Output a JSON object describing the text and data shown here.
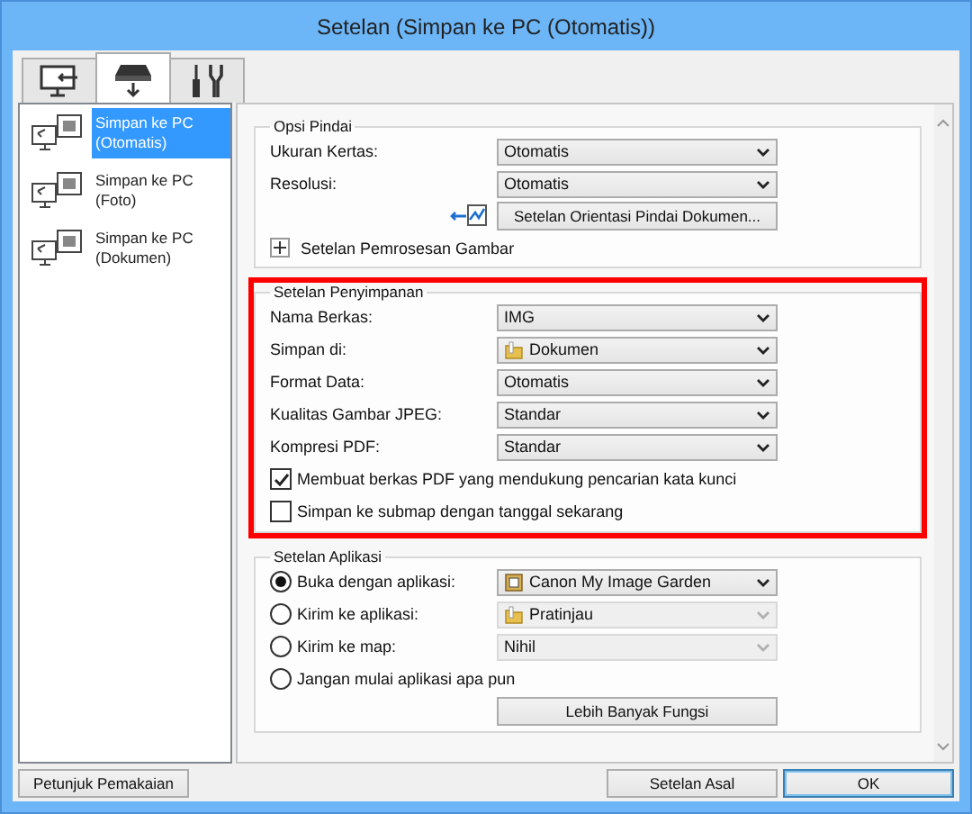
{
  "window": {
    "title": "Setelan (Simpan ke PC (Otomatis))"
  },
  "tabs": [
    {
      "kind": "monitor",
      "selected": false
    },
    {
      "kind": "scanner",
      "selected": true
    },
    {
      "kind": "tools",
      "selected": false
    }
  ],
  "sidebar": {
    "items": [
      {
        "label": "Simpan ke PC\n(Otomatis)",
        "selected": true
      },
      {
        "label": "Simpan ke PC\n(Foto)",
        "selected": false
      },
      {
        "label": "Simpan ke PC\n(Dokumen)",
        "selected": false
      }
    ]
  },
  "sections": [
    {
      "title": "Opsi Pindai",
      "highlighted": false,
      "rows": [
        {
          "kind": "dropdown",
          "label": "Ukuran Kertas:",
          "dropdown": {
            "kind": "plain",
            "value": "Otomatis",
            "disabled": false
          }
        },
        {
          "kind": "dropdown",
          "label": "Resolusi:",
          "dropdown": {
            "kind": "plain",
            "value": "Otomatis",
            "disabled": false
          }
        },
        {
          "kind": "button",
          "label": "Setelan Orientasi Pindai Dokumen..."
        },
        {
          "kind": "expander",
          "label": "Setelan Pemrosesan Gambar",
          "expanded": false
        }
      ]
    },
    {
      "title": "Setelan Penyimpanan",
      "highlighted": true,
      "rows": [
        {
          "kind": "dropdown",
          "label": "Nama Berkas:",
          "dropdown": {
            "kind": "plain",
            "value": "IMG",
            "disabled": false
          }
        },
        {
          "kind": "dropdown",
          "label": "Simpan di:",
          "dropdown": {
            "kind": "folder",
            "value": "Dokumen",
            "disabled": false
          }
        },
        {
          "kind": "dropdown",
          "label": "Format Data:",
          "dropdown": {
            "kind": "plain",
            "value": "Otomatis",
            "disabled": false
          }
        },
        {
          "kind": "dropdown",
          "label": "Kualitas Gambar JPEG:",
          "dropdown": {
            "kind": "plain",
            "value": "Standar",
            "disabled": false
          }
        },
        {
          "kind": "dropdown",
          "label": "Kompresi PDF:",
          "dropdown": {
            "kind": "plain",
            "value": "Standar",
            "disabled": false
          }
        },
        {
          "kind": "checkbox",
          "label": "Membuat berkas PDF yang mendukung pencarian kata kunci",
          "checked": true
        },
        {
          "kind": "checkbox",
          "label": "Simpan ke submap dengan tanggal sekarang",
          "checked": false
        }
      ]
    },
    {
      "title": "Setelan Aplikasi",
      "highlighted": false,
      "rows": [
        {
          "kind": "radio",
          "label": "Buka dengan aplikasi:",
          "selected": true,
          "dropdown": {
            "kind": "app",
            "value": "Canon My Image Garden",
            "disabled": false
          }
        },
        {
          "kind": "radio",
          "label": "Kirim ke aplikasi:",
          "selected": false,
          "dropdown": {
            "kind": "folder",
            "value": "Pratinjau",
            "disabled": true
          }
        },
        {
          "kind": "radio",
          "label": "Kirim ke map:",
          "selected": false,
          "dropdown": {
            "kind": "plain",
            "value": "Nihil",
            "disabled": true
          }
        },
        {
          "kind": "radio",
          "label": "Jangan mulai aplikasi apa pun",
          "selected": false
        },
        {
          "kind": "button",
          "label": "Lebih Banyak Fungsi"
        }
      ]
    }
  ],
  "footer": {
    "left_buttons": [
      {
        "label": "Petunjuk Pemakaian",
        "default": false
      }
    ],
    "right_buttons": [
      {
        "label": "Setelan Asal",
        "default": false
      },
      {
        "label": "OK",
        "default": true
      }
    ]
  }
}
